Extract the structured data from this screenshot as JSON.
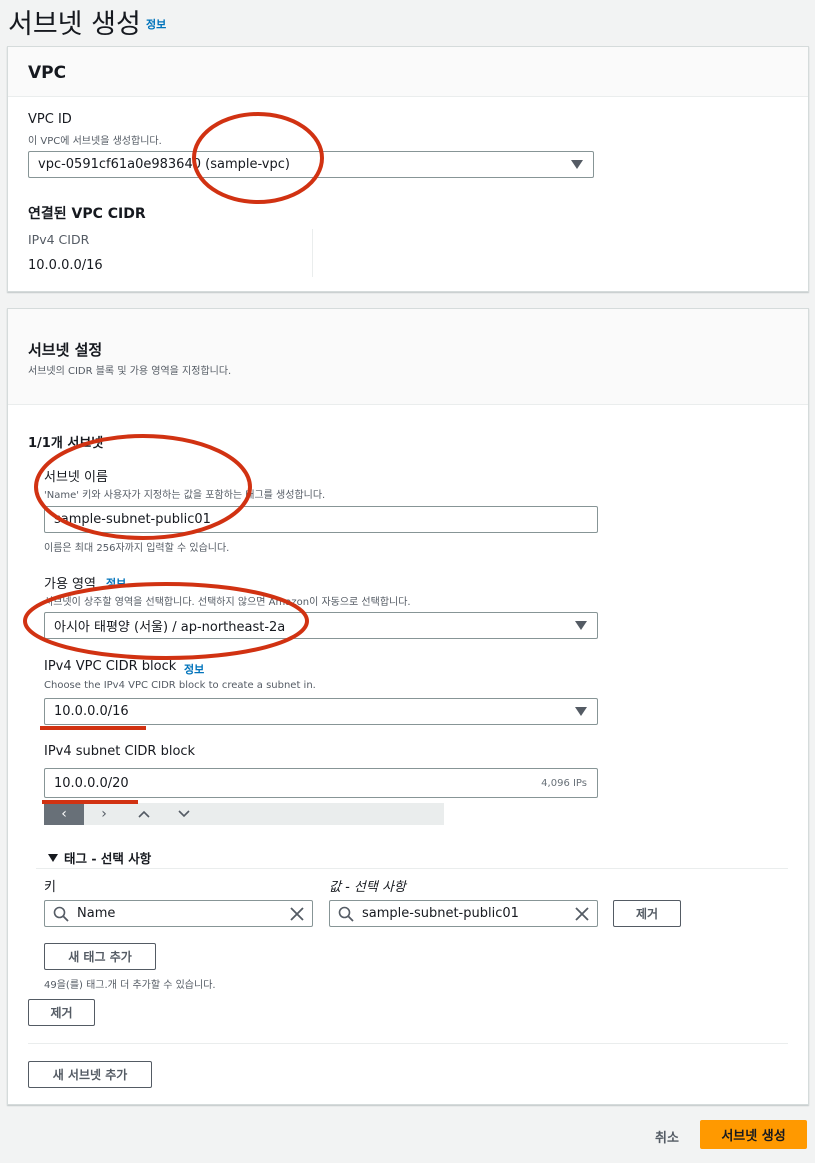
{
  "header": {
    "title": "서브넷 생성",
    "info": "정보"
  },
  "vpc_panel": {
    "title": "VPC",
    "vpc_id_label": "VPC ID",
    "vpc_id_desc": "이 VPC에 서브넷을 생성합니다.",
    "vpc_id_value": "vpc-0591cf61a0e983640 (sample-vpc)",
    "cidr_heading": "연결된 VPC CIDR",
    "ipv4_cidr_label": "IPv4 CIDR",
    "ipv4_cidr_value": "10.0.0.0/16"
  },
  "subnet_panel": {
    "title": "서브넷 설정",
    "desc": "서브넷의 CIDR 블록 및 가용 영역을 지정합니다.",
    "count_heading": "1/1개 서브넷",
    "name_label": "서브넷 이름",
    "name_desc": "'Name' 키와 사용자가 지정하는 값을 포함하는 태그를 생성합니다.",
    "name_value": "sample-subnet-public01",
    "name_hint": "이름은 최대 256자까지 입력할 수 있습니다.",
    "az_label": "가용 영역",
    "az_info": "정보",
    "az_desc": "서브넷이 상주할 영역을 선택합니다. 선택하지 않으면 Amazon이 자동으로 선택합니다.",
    "az_value": "아시아 태평양 (서울) / ap-northeast-2a",
    "vpc_cidr_label": "IPv4 VPC CIDR block",
    "vpc_cidr_info": "정보",
    "vpc_cidr_desc": "Choose the IPv4 VPC CIDR block to create a subnet in.",
    "vpc_cidr_value": "10.0.0.0/16",
    "subnet_cidr_label": "IPv4 subnet CIDR block",
    "subnet_cidr_value": "10.0.0.0/20",
    "subnet_cidr_ips": "4,096 IPs",
    "tags_heading": "태그 - 선택 사항",
    "key_header": "키",
    "value_header": "값 - 선택 사항",
    "tag_key": "Name",
    "tag_value": "sample-subnet-public01",
    "remove_tag": "제거",
    "add_tag": "새 태그 추가",
    "tag_hint": "49을(를) 태그.개 더 추가할 수 있습니다.",
    "remove_subnet": "제거",
    "add_subnet": "새 서브넷 추가"
  },
  "footer": {
    "cancel": "취소",
    "create": "서브넷 생성"
  },
  "colors": {
    "accent": "#ff9900",
    "link": "#0073bb",
    "annotation": "#d13212"
  }
}
